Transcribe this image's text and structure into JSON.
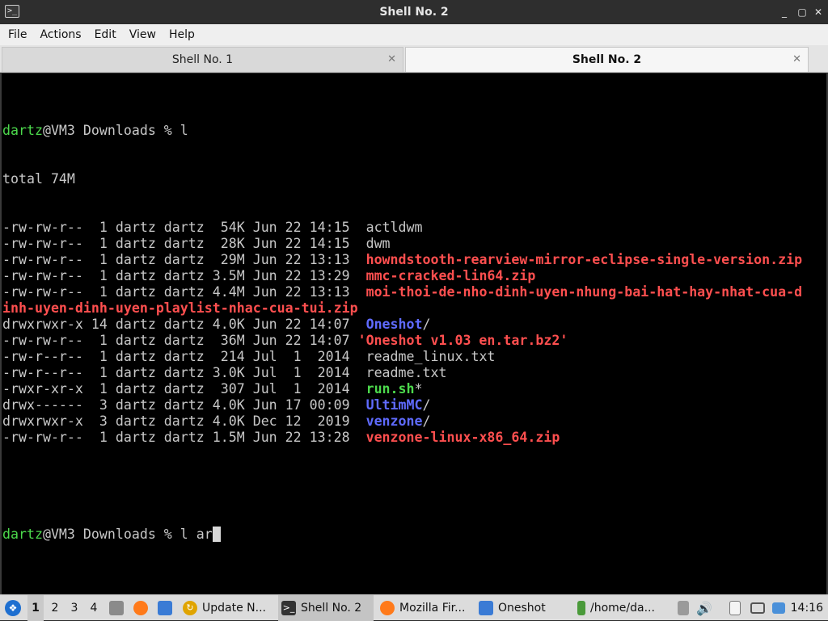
{
  "window": {
    "title": "Shell No. 2",
    "controls": {
      "minimize": "_",
      "maximize": "▢",
      "close": "✕"
    }
  },
  "menu": [
    "File",
    "Actions",
    "Edit",
    "View",
    "Help"
  ],
  "tabs": [
    {
      "label": "Shell No. 1",
      "active": false
    },
    {
      "label": "Shell No. 2",
      "active": true
    }
  ],
  "terminal": {
    "prompt1": {
      "user": "dartz",
      "host": "@VM3 Downloads % ",
      "command": "l"
    },
    "total": "total 74M",
    "entries": [
      {
        "info": "-rw-rw-r--  1 dartz dartz  54K Jun 22 14:15  ",
        "name": "actldwm",
        "style": "plain"
      },
      {
        "info": "-rw-rw-r--  1 dartz dartz  28K Jun 22 14:15  ",
        "name": "dwm",
        "style": "plain"
      },
      {
        "info": "-rw-rw-r--  1 dartz dartz  29M Jun 22 13:13  ",
        "name": "howndstooth-rearview-mirror-eclipse-single-version.zip",
        "style": "archive"
      },
      {
        "info": "-rw-rw-r--  1 dartz dartz 3.5M Jun 22 13:29  ",
        "name": "mmc-cracked-lin64.zip",
        "style": "archive"
      },
      {
        "info": "-rw-rw-r--  1 dartz dartz 4.4M Jun 22 13:13  ",
        "name": "moi-thoi-de-nho-dinh-uyen-nhung-bai-hat-hay-nhat-cua-d",
        "style": "archive"
      },
      {
        "info": "",
        "name": "inh-uyen-dinh-uyen-playlist-nhac-cua-tui.zip",
        "style": "archive"
      },
      {
        "info": "drwxrwxr-x 14 dartz dartz 4.0K Jun 22 14:07  ",
        "name": "Oneshot",
        "suffix": "/",
        "style": "dir"
      },
      {
        "info": "-rw-rw-r--  1 dartz dartz  36M Jun 22 14:07 ",
        "name": "'Oneshot v1.03 en.tar.bz2'",
        "style": "archive"
      },
      {
        "info": "-rw-r--r--  1 dartz dartz  214 Jul  1  2014  ",
        "name": "readme_linux.txt",
        "style": "plain"
      },
      {
        "info": "-rw-r--r--  1 dartz dartz 3.0K Jul  1  2014  ",
        "name": "readme.txt",
        "style": "plain"
      },
      {
        "info": "-rwxr-xr-x  1 dartz dartz  307 Jul  1  2014  ",
        "name": "run.sh",
        "suffix": "*",
        "style": "exec"
      },
      {
        "info": "drwx------  3 dartz dartz 4.0K Jun 17 00:09  ",
        "name": "UltimMC",
        "suffix": "/",
        "style": "dir"
      },
      {
        "info": "drwxrwxr-x  3 dartz dartz 4.0K Dec 12  2019  ",
        "name": "venzone",
        "suffix": "/",
        "style": "dir"
      },
      {
        "info": "-rw-rw-r--  1 dartz dartz 1.5M Jun 22 13:28  ",
        "name": "venzone-linux-x86_64.zip",
        "style": "archive"
      }
    ],
    "prompt2": {
      "user": "dartz",
      "host": "@VM3 Downloads % ",
      "command": "l ar"
    }
  },
  "taskbar": {
    "workspaces": [
      "1",
      "2",
      "3",
      "4"
    ],
    "active_workspace": "1",
    "tasks": [
      {
        "label": "Update N...",
        "icon": "update-icon",
        "active": false
      },
      {
        "label": "Shell No. 2",
        "icon": "terminal-icon",
        "active": true
      },
      {
        "label": "Mozilla Fir...",
        "icon": "firefox-icon",
        "active": false
      },
      {
        "label": "Oneshot",
        "icon": "folder-icon",
        "active": false
      },
      {
        "label": "/home/da...",
        "icon": "terminal-icon",
        "active": false
      }
    ],
    "clock": "14:16",
    "colors": {
      "accent": "#1e6fd0",
      "archive": "#ff4f4f",
      "dir": "#5f6bff",
      "exec": "#4cd94c"
    }
  }
}
